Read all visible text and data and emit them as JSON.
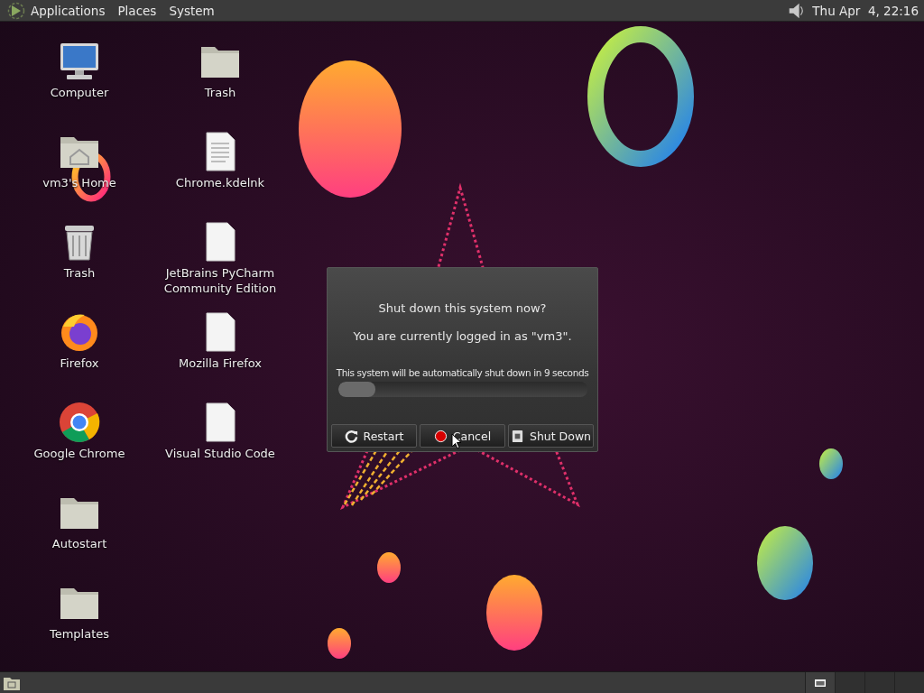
{
  "top_panel": {
    "menus": [
      {
        "label": "Applications"
      },
      {
        "label": "Places"
      },
      {
        "label": "System"
      }
    ],
    "clock": "Thu Apr  4, 22:16"
  },
  "desktop_icons": [
    {
      "label": "Computer",
      "kind": "computer"
    },
    {
      "label": "vm3's Home",
      "kind": "home"
    },
    {
      "label": "Trash",
      "kind": "trash"
    },
    {
      "label": "Firefox",
      "kind": "firefox"
    },
    {
      "label": "Google Chrome",
      "kind": "chrome"
    },
    {
      "label": "Autostart",
      "kind": "folder"
    },
    {
      "label": "Templates",
      "kind": "folder"
    },
    {
      "label": "Trash",
      "kind": "folder"
    },
    {
      "label": "Chrome.kdelnk",
      "kind": "textfile"
    },
    {
      "label": "JetBrains PyCharm Community Edition",
      "kind": "file"
    },
    {
      "label": "Mozilla Firefox",
      "kind": "file"
    },
    {
      "label": "Visual Studio Code",
      "kind": "file"
    }
  ],
  "dialog": {
    "title": "Shut down this system now?",
    "message": "You are currently logged in as \"vm3\".",
    "countdown": "This system will be automatically shut down in 9 seconds",
    "level": 0.15,
    "buttons": [
      {
        "label": "Restart",
        "kind": "restart"
      },
      {
        "label": "Cancel",
        "kind": "cancel"
      },
      {
        "label": "Shut Down",
        "kind": "shutdown"
      }
    ]
  },
  "bottom_panel": {
    "workspaces": [
      {
        "selected": true
      },
      {
        "selected": false
      },
      {
        "selected": false
      },
      {
        "selected": false
      }
    ]
  }
}
